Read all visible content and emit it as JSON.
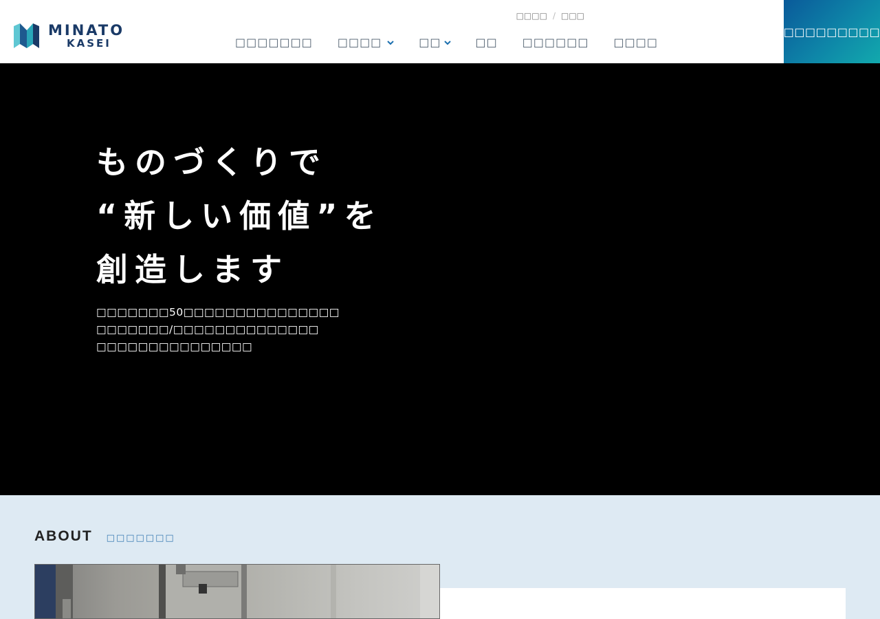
{
  "header": {
    "logo": {
      "line1": "MINATO",
      "line2": "KASEI"
    },
    "subnav": [
      "□□□□",
      "□□□"
    ],
    "subnav_separator": "/",
    "nav": [
      {
        "label": "□□□□□□□",
        "has_dropdown": false
      },
      {
        "label": "□□□□",
        "has_dropdown": true
      },
      {
        "label": "□□",
        "has_dropdown": true
      },
      {
        "label": "□□",
        "has_dropdown": false
      },
      {
        "label": "□□□□□□",
        "has_dropdown": false
      },
      {
        "label": "□□□□",
        "has_dropdown": false
      }
    ],
    "dropdown_icon": "chevron-down-icon",
    "contact_label": "□□□□□□□□□□□"
  },
  "hero": {
    "title_lines": [
      "ものづくりで",
      "“新しい価値”を",
      "創造します"
    ],
    "desc_lines": [
      "□□□□□□□50□□□□□□□□□□□□□□□",
      "□□□□□□□/□□□□□□□□□□□□□□",
      "□□□□□□□□□□□□□□□"
    ]
  },
  "about": {
    "title": "ABOUT",
    "subtitle": "□□□□□□□"
  },
  "colors": {
    "brand_navy": "#1a3a67",
    "accent_blue": "#1a6fae",
    "contact_gradient_start": "#0a5a9a",
    "contact_gradient_end": "#12a9ad",
    "hero_bg": "#000000",
    "about_bg": "#deeaf3"
  }
}
